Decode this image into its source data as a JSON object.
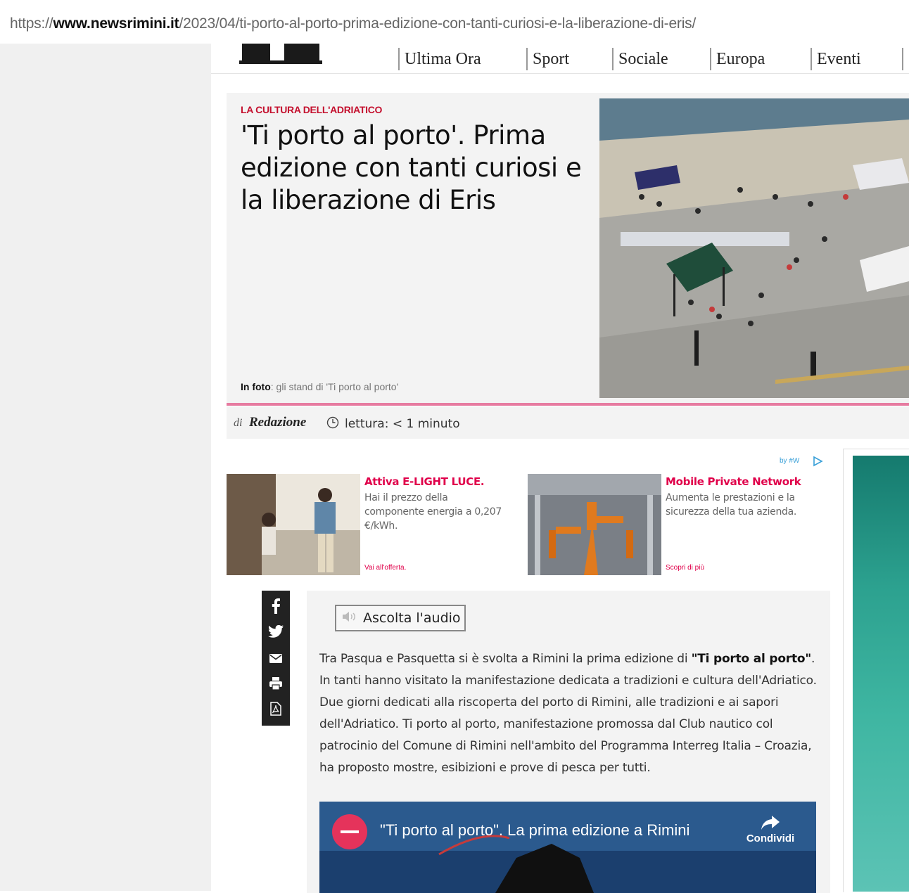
{
  "browser": {
    "url_prefix": "https://",
    "url_domain": "www.newsrimini.it",
    "url_path": "/2023/04/ti-porto-al-porto-prima-edizione-con-tanti-curiosi-e-la-liberazione-di-eris/"
  },
  "nav": {
    "items": [
      "Ultima Ora",
      "Sport",
      "Sociale",
      "Europa",
      "Eventi"
    ]
  },
  "article": {
    "kicker": "LA CULTURA DELL'ADRIATICO",
    "headline": "'Ti porto al porto'. Prima edizione con tanti curiosi e la liberazione di Eris",
    "caption_label": "In foto",
    "caption_text": ": gli stand di 'Ti porto al porto'",
    "byline_di": "di",
    "byline_author": "Redazione",
    "reading_time": "lettura: < 1 minuto",
    "audio_button": "Ascolta l'audio",
    "body_intro": "Tra Pasqua e Pasquetta si è svolta a Rimini la prima edizione di ",
    "body_bold": "\"Ti porto al porto\"",
    "body_rest": ". In tanti hanno visitato la manifestazione dedicata a tradizioni e cultura dell'Adriatico. Due giorni dedicati alla riscoperta del porto di Rimini, alle tradizioni e ai sapori dell'Adriatico. Ti porto al porto, manifestazione promossa dal Club nautico col patrocinio del Comune di Rimini nell'ambito del Programma Interreg Italia – Croazia, ha proposto mostre, esibizioni e prove di pesca per tutti."
  },
  "ads": {
    "choice_label": "by #W",
    "items": [
      {
        "title": "Attiva E-LIGHT LUCE.",
        "text": "Hai il prezzo della componente energia a 0,207 €/kWh.",
        "link": "Vai all'offerta."
      },
      {
        "title": "Mobile Private Network",
        "text": "Aumenta le prestazioni e la sicurezza della tua azienda.",
        "link": "Scopri di più"
      }
    ]
  },
  "share": {
    "icons": [
      "facebook-icon",
      "twitter-icon",
      "email-icon",
      "print-icon",
      "pdf-icon"
    ]
  },
  "video": {
    "title": "\"Ti porto al porto\". La prima edizione a Rimini",
    "share_label": "Condividi"
  },
  "colors": {
    "accent_red": "#c4102e",
    "ad_pink": "#e0004a",
    "hero_underline": "#e67ba0",
    "panel_bg": "#f3f3f3"
  }
}
